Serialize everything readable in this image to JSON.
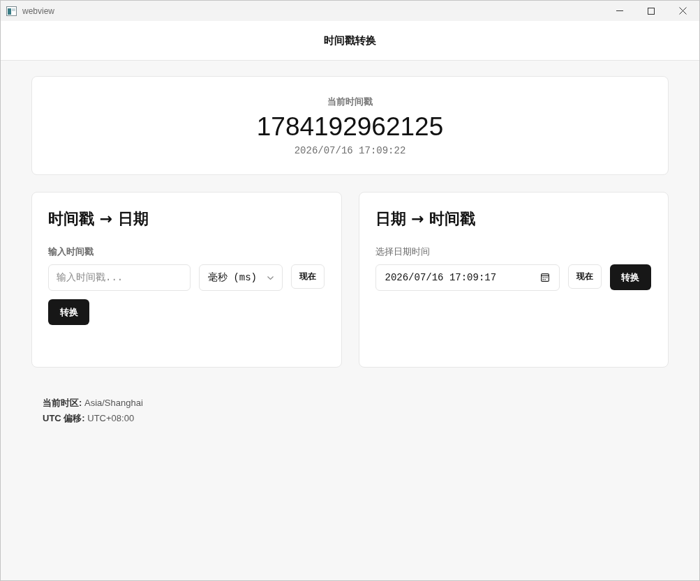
{
  "window": {
    "title": "webview"
  },
  "header": {
    "title": "时间戳转换"
  },
  "current": {
    "label": "当前时间戳",
    "timestamp": "1784192962125",
    "datetime": "2026/07/16 17:09:22"
  },
  "panels": [
    {
      "kind": "timestamp",
      "title": "时间戳 → 日期",
      "field_label": "输入时间戳",
      "input": {
        "placeholder": "输入时间戳..."
      },
      "unit_select": {
        "value": "毫秒 (ms)"
      },
      "now_button": "现在",
      "convert_button": "转换"
    },
    {
      "kind": "datetime",
      "title": "日期 → 时间戳",
      "field_label": "选择日期时间",
      "input": {
        "value": "2026/07/16 17:09:17"
      },
      "now_button": "现在",
      "convert_button": "转换"
    }
  ],
  "footer": {
    "lines": [
      "**当前时区:** Asia/Shanghai",
      "**UTC 偏移:** UTC+08:00"
    ]
  }
}
